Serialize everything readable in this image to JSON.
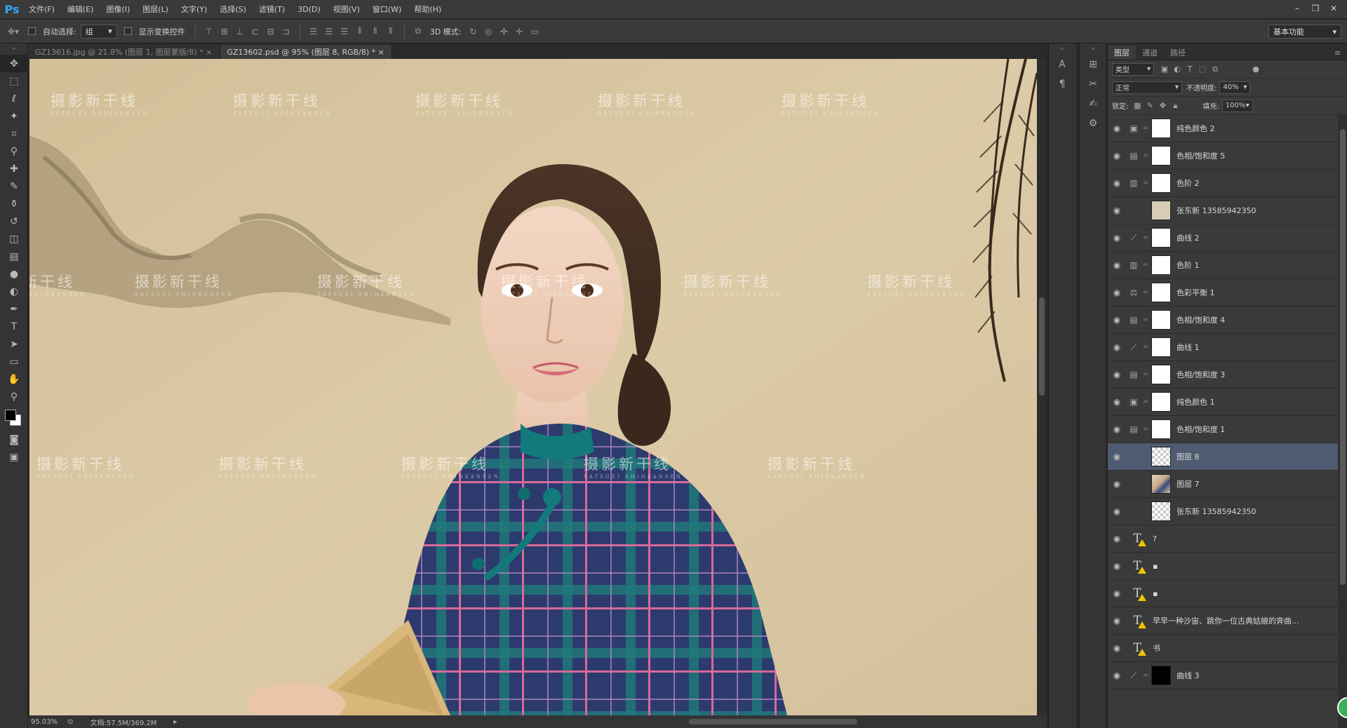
{
  "app": {
    "logo": "Ps"
  },
  "menu": [
    "文件(F)",
    "编辑(E)",
    "图像(I)",
    "图层(L)",
    "文字(Y)",
    "选择(S)",
    "滤镜(T)",
    "3D(D)",
    "视图(V)",
    "窗口(W)",
    "帮助(H)"
  ],
  "window_controls": [
    "–",
    "❐",
    "✕"
  ],
  "options": {
    "auto_select_label": "自动选择:",
    "auto_select_value": "组",
    "show_transform_label": "显示变换控件",
    "mode_3d_label": "3D 模式:",
    "workspace": "基本功能"
  },
  "tabs": [
    {
      "label": "GZ13616.jpg @ 21.8% (图层 1, 图层蒙版/8) *",
      "close": "×"
    },
    {
      "label": "GZ13602.psd @ 95% (图层 8, RGB/8) *",
      "close": "×"
    }
  ],
  "watermark": {
    "text": "摄影新干线",
    "sub": "SATSUEI SHINKANSEN"
  },
  "status": {
    "zoom": "95.03%",
    "doc": "文档:57.5M/369.2M"
  },
  "layers_panel": {
    "tabs": [
      "图层",
      "通道",
      "路径"
    ],
    "kind": "类型",
    "blend_mode": "正常",
    "opacity_label": "不透明度:",
    "opacity_value": "40%",
    "lock_label": "锁定:",
    "fill_label": "填充:",
    "fill_value": "100%",
    "layers": [
      {
        "name": "纯色颜色 2",
        "thumb": "t-white",
        "icon": "▣",
        "selected": false
      },
      {
        "name": "色相/饱和度 5",
        "thumb": "t-white",
        "icon": "▤",
        "selected": false
      },
      {
        "name": "色阶 2",
        "thumb": "t-white",
        "icon": "▥",
        "selected": false
      },
      {
        "name": "张东新 13585942350",
        "thumb": "t-beige",
        "icon": "",
        "selected": false
      },
      {
        "name": "曲线 2",
        "thumb": "t-white",
        "icon": "⟋",
        "selected": false
      },
      {
        "name": "色阶 1",
        "thumb": "t-white",
        "icon": "▥",
        "selected": false
      },
      {
        "name": "色彩平衡 1",
        "thumb": "t-white",
        "icon": "⚖",
        "selected": false
      },
      {
        "name": "色相/饱和度 4",
        "thumb": "t-white",
        "icon": "▤",
        "selected": false
      },
      {
        "name": "曲线 1",
        "thumb": "t-white",
        "icon": "⟋",
        "selected": false
      },
      {
        "name": "色相/饱和度 3",
        "thumb": "t-white",
        "icon": "▤",
        "selected": false
      },
      {
        "name": "纯色颜色 1",
        "thumb": "t-white",
        "icon": "▣",
        "selected": false
      },
      {
        "name": "色相/饱和度 1",
        "thumb": "t-white",
        "icon": "▤",
        "selected": false
      },
      {
        "name": "图层 8",
        "thumb": "t-check",
        "icon": "",
        "selected": true
      },
      {
        "name": "图层 7",
        "thumb": "t-person",
        "icon": "",
        "selected": false
      },
      {
        "name": "张东新 13585942350",
        "thumb": "t-check",
        "icon": "",
        "selected": false
      },
      {
        "name": "?",
        "thumb": "text",
        "icon": "",
        "selected": false
      },
      {
        "name": "▪",
        "thumb": "text",
        "icon": "",
        "selected": false
      },
      {
        "name": "▪",
        "thumb": "text",
        "icon": "",
        "selected": false
      },
      {
        "name": "早早一种沙宙、跳你一位古典姑娘的奔曲...",
        "thumb": "text",
        "icon": "",
        "selected": false
      },
      {
        "name": "书",
        "thumb": "text",
        "icon": "",
        "selected": false
      },
      {
        "name": "曲线 3",
        "thumb": "t-black",
        "icon": "⟋",
        "selected": false
      }
    ]
  }
}
